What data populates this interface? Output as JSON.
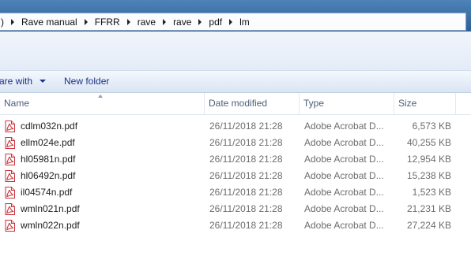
{
  "address": {
    "lead": ")",
    "crumbs": [
      "Rave manual",
      "FFRR",
      "rave",
      "rave",
      "pdf",
      "lm"
    ]
  },
  "commandbar": {
    "share_label": "are with",
    "new_folder_label": "New folder"
  },
  "columns": {
    "name": "Name",
    "date": "Date modified",
    "type": "Type",
    "size": "Size"
  },
  "files": [
    {
      "name": "cdlm032n.pdf",
      "date": "26/11/2018 21:28",
      "type": "Adobe Acrobat D...",
      "size": "6,573 KB",
      "icon": "pdf-icon"
    },
    {
      "name": "ellm024e.pdf",
      "date": "26/11/2018 21:28",
      "type": "Adobe Acrobat D...",
      "size": "40,255 KB",
      "icon": "pdf-icon"
    },
    {
      "name": "hl05981n.pdf",
      "date": "26/11/2018 21:28",
      "type": "Adobe Acrobat D...",
      "size": "12,954 KB",
      "icon": "pdf-icon"
    },
    {
      "name": "hl06492n.pdf",
      "date": "26/11/2018 21:28",
      "type": "Adobe Acrobat D...",
      "size": "15,238 KB",
      "icon": "pdf-icon"
    },
    {
      "name": "il04574n.pdf",
      "date": "26/11/2018 21:28",
      "type": "Adobe Acrobat D...",
      "size": "1,523 KB",
      "icon": "pdf-icon"
    },
    {
      "name": "wmln021n.pdf",
      "date": "26/11/2018 21:28",
      "type": "Adobe Acrobat D...",
      "size": "21,231 KB",
      "icon": "pdf-icon"
    },
    {
      "name": "wmln022n.pdf",
      "date": "26/11/2018 21:28",
      "type": "Adobe Acrobat D...",
      "size": "27,224 KB",
      "icon": "pdf-icon"
    }
  ]
}
